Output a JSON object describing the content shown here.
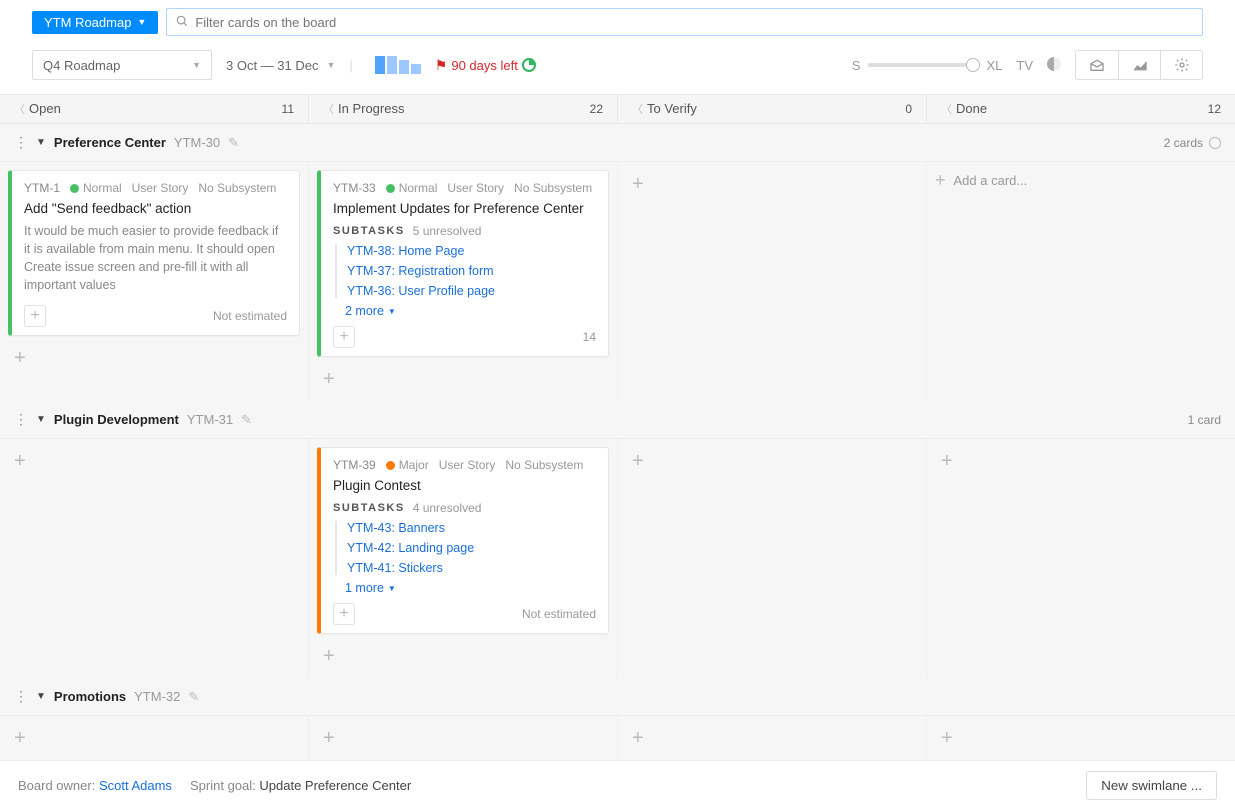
{
  "header": {
    "board_name": "YTM Roadmap",
    "filter_placeholder": "Filter cards on the board"
  },
  "toolbar": {
    "sprint": "Q4 Roadmap",
    "date_range": "3 Oct — 31 Dec",
    "days_left": "90 days left",
    "zoom_s": "S",
    "zoom_xl": "XL",
    "tv": "TV"
  },
  "columns": [
    {
      "name": "Open",
      "count": "11"
    },
    {
      "name": "In Progress",
      "count": "22"
    },
    {
      "name": "To Verify",
      "count": "0"
    },
    {
      "name": "Done",
      "count": "12"
    }
  ],
  "swimlanes": {
    "preference": {
      "title": "Preference Center",
      "code": "YTM-30",
      "summary": "2 cards",
      "card_open": {
        "id": "YTM-1",
        "priority": "Normal",
        "type": "User Story",
        "subsystem": "No Subsystem",
        "title": "Add \"Send feedback\" action",
        "desc": "It would be much easier to provide feedback if it is available from main menu. It should open Create issue screen and pre-fill it with all important values",
        "estimate": "Not estimated"
      },
      "card_inprogress": {
        "id": "YTM-33",
        "priority": "Normal",
        "type": "User Story",
        "subsystem": "No Subsystem",
        "title": "Implement Updates for Preference Center",
        "subtasks_label": "SUBTASKS",
        "unresolved": "5 unresolved",
        "subtasks": [
          "YTM-38: Home Page",
          "YTM-37: Registration form",
          "YTM-36: User Profile page"
        ],
        "more": "2 more",
        "estimate": "14"
      },
      "done_add": "Add a card..."
    },
    "plugin": {
      "title": "Plugin Development",
      "code": "YTM-31",
      "summary": "1 card",
      "card_inprogress": {
        "id": "YTM-39",
        "priority": "Major",
        "type": "User Story",
        "subsystem": "No Subsystem",
        "title": "Plugin Contest",
        "subtasks_label": "SUBTASKS",
        "unresolved": "4 unresolved",
        "subtasks": [
          "YTM-43: Banners",
          "YTM-42: Landing page",
          "YTM-41: Stickers"
        ],
        "more": "1 more",
        "estimate": "Not estimated"
      }
    },
    "promotions": {
      "title": "Promotions",
      "code": "YTM-32"
    }
  },
  "footer": {
    "owner_label": "Board owner:",
    "owner": "Scott Adams",
    "goal_label": "Sprint goal:",
    "goal": "Update Preference Center",
    "new_swimlane": "New swimlane ..."
  }
}
